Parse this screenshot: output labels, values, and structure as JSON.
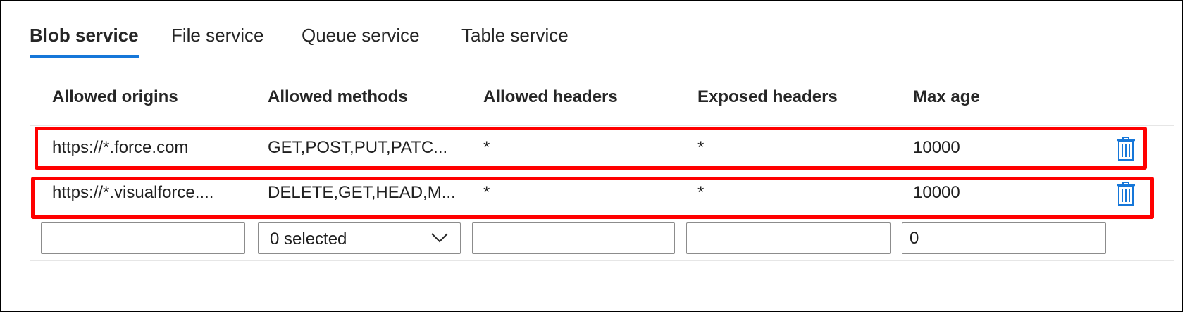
{
  "tabs": [
    {
      "label": "Blob service",
      "active": true
    },
    {
      "label": "File service",
      "active": false
    },
    {
      "label": "Queue service",
      "active": false
    },
    {
      "label": "Table service",
      "active": false
    }
  ],
  "columns": [
    "Allowed origins",
    "Allowed methods",
    "Allowed headers",
    "Exposed headers",
    "Max age"
  ],
  "rows": [
    {
      "origins": "https://*.force.com",
      "methods": "GET,POST,PUT,PATC...",
      "allowed_headers": "*",
      "exposed_headers": "*",
      "max_age": "10000",
      "delete_icon": "trash-icon"
    },
    {
      "origins": "https://*.visualforce....",
      "methods": "DELETE,GET,HEAD,M...",
      "allowed_headers": "*",
      "exposed_headers": "*",
      "max_age": "10000",
      "delete_icon": "trash-icon"
    }
  ],
  "new_row": {
    "origins_value": "",
    "methods_selected": "0 selected",
    "allowed_headers_value": "",
    "exposed_headers_value": "",
    "max_age_value": "0"
  },
  "colors": {
    "accent": "#1677d9",
    "highlight": "#ff0000",
    "icon": "#1677d9"
  }
}
